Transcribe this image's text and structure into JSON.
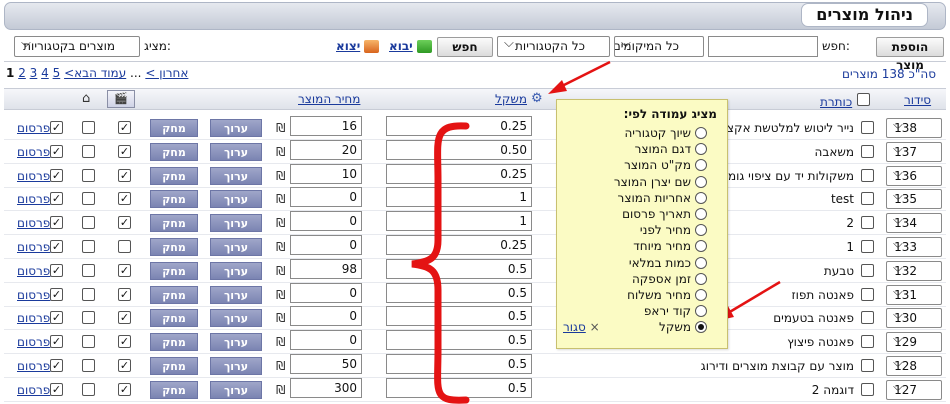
{
  "header": {
    "title": "ניהול מוצרים"
  },
  "toolbar": {
    "add_product": "הוספת מוצר",
    "search_label": "חפש:",
    "search_value": "",
    "search_button": "חפש",
    "location_select": "כל המיקומים",
    "category_select": "כל הקטגוריות",
    "import": "יבוא",
    "export": "יצוא",
    "show_label": "מציג:",
    "show_select": "מוצרים בקטגוריות"
  },
  "pagination": {
    "total": "סה\"כ 138 מוצרים",
    "current": "1",
    "pages": [
      "2",
      "3",
      "4",
      "5"
    ],
    "next": "עמוד הבא>",
    "dots": "...",
    "last": "אחרון >"
  },
  "table": {
    "headers": {
      "order": "סידור",
      "title": "כותרת",
      "weight": "משקל",
      "price": "מחיר המוצר"
    },
    "edit_label": "ערוך",
    "delete_label": "מחק",
    "publish_label": "פרסום",
    "currency": "₪",
    "rows": [
      {
        "order": "138",
        "name": "נייר ליטוש למלטשת אקצנטרית",
        "weight": "0.25",
        "price": "16",
        "checked_a": true,
        "checked_b": false,
        "published": true
      },
      {
        "order": "137",
        "name": "משאבה",
        "weight": "0.50",
        "price": "20",
        "checked_a": true,
        "checked_b": false,
        "published": true
      },
      {
        "order": "136",
        "name": "משקולות יד עם ציפוי גומי",
        "weight": "0.25",
        "price": "10",
        "checked_a": true,
        "checked_b": false,
        "published": true
      },
      {
        "order": "135",
        "name": "test",
        "weight": "1",
        "price": "0",
        "checked_a": true,
        "checked_b": false,
        "published": true
      },
      {
        "order": "134",
        "name": "2",
        "weight": "1",
        "price": "0",
        "checked_a": true,
        "checked_b": false,
        "published": true
      },
      {
        "order": "133",
        "name": "1",
        "weight": "0.25",
        "price": "0",
        "checked_a": false,
        "checked_b": false,
        "published": true
      },
      {
        "order": "132",
        "name": "טבעת",
        "weight": "0.5",
        "price": "98",
        "checked_a": true,
        "checked_b": false,
        "published": true
      },
      {
        "order": "131",
        "name": "פאנטה תפוז",
        "weight": "0.5",
        "price": "0",
        "checked_a": true,
        "checked_b": false,
        "published": true
      },
      {
        "order": "130",
        "name": "פאנטה בטעמים",
        "weight": "0.5",
        "price": "0",
        "checked_a": true,
        "checked_b": false,
        "published": true
      },
      {
        "order": "129",
        "name": "פאנטה פיצוץ",
        "weight": "0.5",
        "price": "0",
        "checked_a": true,
        "checked_b": false,
        "published": true
      },
      {
        "order": "128",
        "name": "מוצר עם קבוצת מוצרים ודירוג",
        "weight": "0.5",
        "price": "50",
        "checked_a": true,
        "checked_b": false,
        "published": true
      },
      {
        "order": "127",
        "name": "דוגמה 2",
        "weight": "0.5",
        "price": "300",
        "checked_a": true,
        "checked_b": false,
        "published": true
      }
    ]
  },
  "popup": {
    "title": "מציג עמודה לפי:",
    "options": [
      "שיוך קטגוריה",
      "דגם המוצר",
      "מק\"ט המוצר",
      "שם יצרן המוצר",
      "אחריות המוצר",
      "תאריך פרסום",
      "מחיר לפני",
      "מחיר מיוחד",
      "כמות במלאי",
      "זמן אספקה",
      "מחיר משלוח",
      "קוד יראפ",
      "משקל"
    ],
    "selected_index": 12,
    "close": "סגור",
    "close_x": "×"
  }
}
